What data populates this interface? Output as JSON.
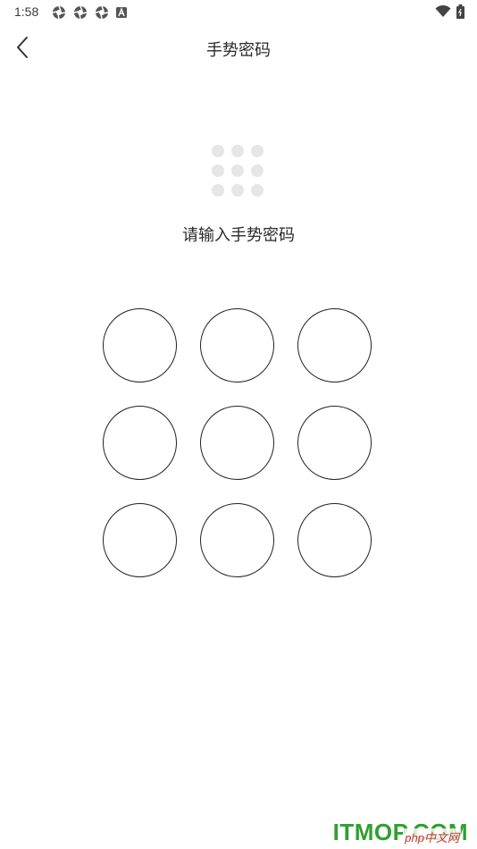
{
  "status_bar": {
    "time": "1:58",
    "left_icons": [
      "aperture-icon",
      "aperture-icon",
      "aperture-icon",
      "a-box-icon"
    ],
    "right_icons": [
      "wifi-icon",
      "battery-icon"
    ]
  },
  "header": {
    "title": "手势密码",
    "back_icon": "chevron-left-icon"
  },
  "preview": {
    "dot_count": 9,
    "dot_color": "#e6e6e6"
  },
  "prompt": {
    "text": "请输入手势密码"
  },
  "gesture_pad": {
    "node_count": 9,
    "node_border_color": "#222222"
  },
  "watermark": {
    "text": "ITMOP.COM",
    "sub_text": "php中文网",
    "color": "#2fa02f"
  }
}
